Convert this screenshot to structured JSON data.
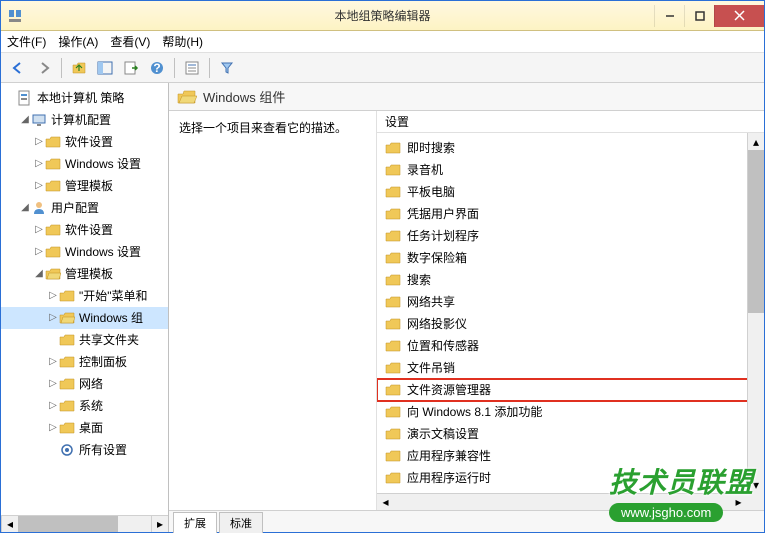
{
  "window": {
    "title": "本地组策略编辑器"
  },
  "menu": {
    "file": "文件(F)",
    "action": "操作(A)",
    "view": "查看(V)",
    "help": "帮助(H)"
  },
  "tree": {
    "root": "本地计算机 策略",
    "computer_config": "计算机配置",
    "cc_software": "软件设置",
    "cc_windows": "Windows 设置",
    "cc_templates": "管理模板",
    "user_config": "用户配置",
    "uc_software": "软件设置",
    "uc_windows": "Windows 设置",
    "uc_templates": "管理模板",
    "start_menu": "\"开始\"菜单和",
    "windows_comp": "Windows 组",
    "shared_folders": "共享文件夹",
    "control_panel": "控制面板",
    "network": "网络",
    "system": "系统",
    "desktop": "桌面",
    "all_settings": "所有设置"
  },
  "header": {
    "title": "Windows 组件"
  },
  "description": "选择一个项目来查看它的描述。",
  "list_header": "设置",
  "items": [
    "即时搜索",
    "录音机",
    "平板电脑",
    "凭据用户界面",
    "任务计划程序",
    "数字保险箱",
    "搜索",
    "网络共享",
    "网络投影仪",
    "位置和传感器",
    "文件吊销",
    "文件资源管理器",
    "向 Windows 8.1 添加功能",
    "演示文稿设置",
    "应用程序兼容性",
    "应用程序运行时"
  ],
  "highlighted_index": 11,
  "tabs": {
    "extended": "扩展",
    "standard": "标准"
  },
  "watermark": {
    "logo": "技术员联盟",
    "url": "www.jsgho.com"
  }
}
